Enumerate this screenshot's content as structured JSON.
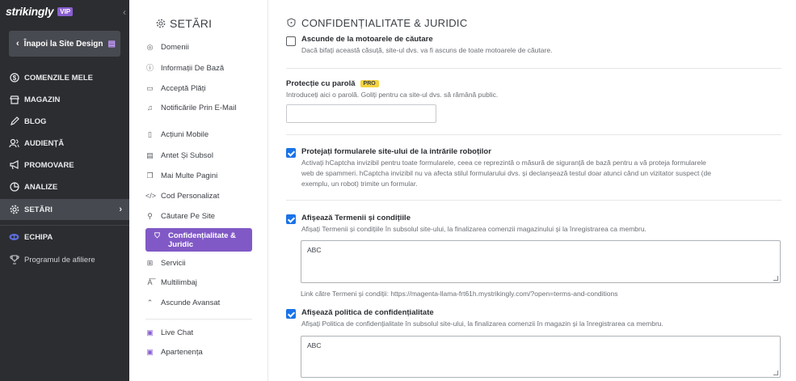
{
  "sidebar": {
    "brand": "strikingly",
    "badge": "VIP",
    "back_label": "Înapoi la Site Design",
    "items": [
      {
        "label": "COMENZILE MELE",
        "icon": "dollar-icon"
      },
      {
        "label": "MAGAZIN",
        "icon": "store-icon"
      },
      {
        "label": "BLOG",
        "icon": "pen-icon"
      },
      {
        "label": "AUDIENȚĂ",
        "icon": "people-icon"
      },
      {
        "label": "PROMOVARE",
        "icon": "megaphone-icon"
      },
      {
        "label": "ANALIZE",
        "icon": "pie-chart-icon"
      },
      {
        "label": "SETĂRI",
        "icon": "gear-icon"
      }
    ],
    "extra": [
      {
        "label": "ECHIPA",
        "icon": "team-icon"
      },
      {
        "label": "Programul de afiliere",
        "icon": "trophy-icon"
      }
    ]
  },
  "settings": {
    "title": "SETĂRI",
    "items": [
      {
        "label": "Domenii",
        "icon": "globe-icon"
      },
      {
        "label": "Informații De Bază",
        "icon": "info-icon"
      },
      {
        "label": "Acceptă Plăți",
        "icon": "payment-icon"
      },
      {
        "label": "Notificările Prin E-Mail",
        "icon": "bell-icon"
      },
      {
        "label": "Acțiuni Mobile",
        "icon": "mobile-icon"
      },
      {
        "label": "Antet Și Subsol",
        "icon": "layout-icon"
      },
      {
        "label": "Mai Multe Pagini",
        "icon": "pages-icon"
      },
      {
        "label": "Cod Personalizat",
        "icon": "code-icon"
      },
      {
        "label": "Căutare Pe Site",
        "icon": "search-icon"
      },
      {
        "label": "Confidențialitate & Juridic",
        "icon": "shield-icon"
      },
      {
        "label": "Servicii",
        "icon": "grid-icon"
      },
      {
        "label": "Multilimbaj",
        "icon": "language-icon"
      },
      {
        "label": "Ascunde Avansat",
        "icon": "chevron-up-icon"
      },
      {
        "label": "Live Chat",
        "icon": "chat-icon"
      },
      {
        "label": "Apartenența",
        "icon": "membership-icon"
      }
    ]
  },
  "main": {
    "title": "CONFIDENȚIALITATE & JURIDIC",
    "hide_search": {
      "label": "Ascunde de la motoarele de căutare",
      "desc": "Dacă bifați această căsuță, site-ul dvs. va fi ascuns de toate motoarele de căutare.",
      "checked": false
    },
    "password": {
      "label": "Protecție cu parolă",
      "badge": "PRO",
      "desc": "Introduceți aici o parolă. Goliți pentru ca site-ul dvs. să rămână public.",
      "value": ""
    },
    "captcha": {
      "label": "Protejați formularele site-ului de la intrările roboților",
      "desc1": "Activați hCaptcha invizibil pentru toate formularele, ceea ce reprezintă o măsură de siguranță de bază pentru a vă proteja formularele",
      "desc2": "web de spammeri. hCaptcha invizibil nu va afecta stilul formularului dvs. și declanșează testul doar atunci când un vizitator suspect (de",
      "desc3": "exemplu, un robot) trimite un formular.",
      "checked": true
    },
    "terms": {
      "label": "Afișează Termenii și condițiile",
      "desc": "Afișați Termenii și condițiile în subsolul site-ului, la finalizarea comenzii magazinului și la înregistrarea ca membru.",
      "value": "ABC",
      "link": "Link către Termeni și condiții: https://magenta-llama-frt61h.mystrikingly.com/?open=terms-and-conditions",
      "checked": true
    },
    "privacy": {
      "label": "Afișează politica de confidențialitate",
      "desc": "Afișați Politica de confidențialitate în subsolul site-ului, la finalizarea comenzii în magazin și la înregistrarea ca membru.",
      "value": "ABC",
      "checked": true
    }
  }
}
